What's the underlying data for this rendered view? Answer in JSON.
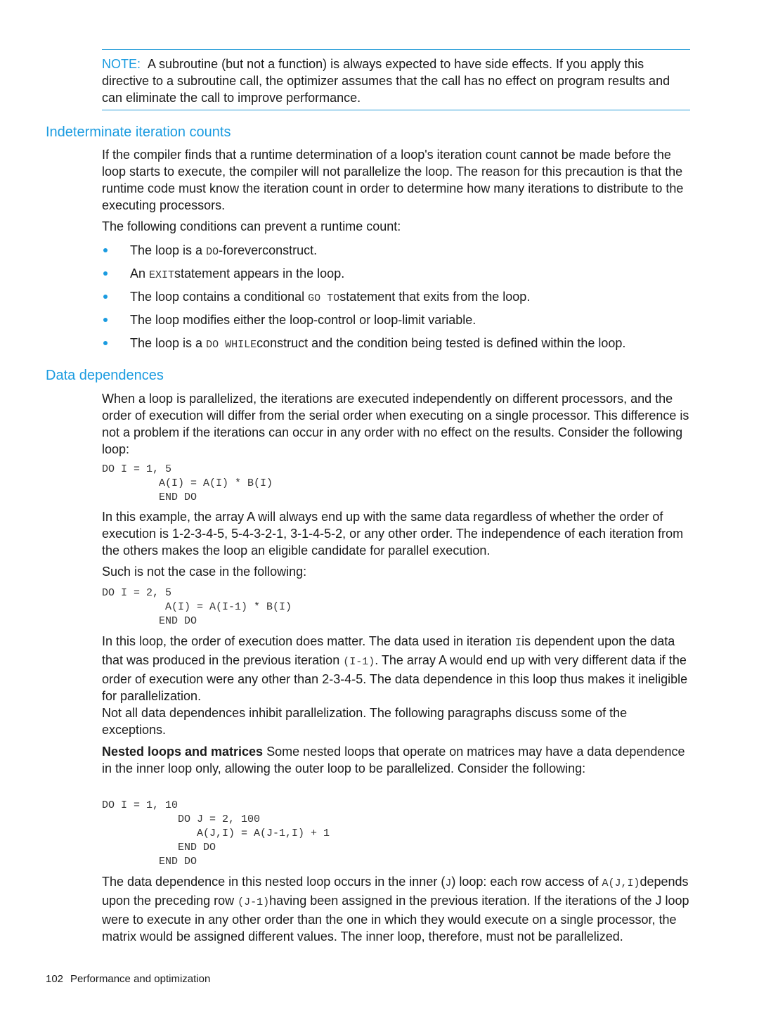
{
  "note": {
    "label": "NOTE:",
    "text": "A subroutine (but not a function) is always expected to have side effects. If you apply this directive to a subroutine call, the optimizer assumes that the call has no effect on program results and can eliminate the call to improve performance."
  },
  "section1": {
    "heading": "Indeterminate iteration counts",
    "para1": "If the compiler finds that a runtime determination of a loop's iteration count cannot be made before the loop starts to execute, the compiler will not parallelize the loop. The reason for this precaution is that the runtime code must know the iteration count in order to determine how many iterations to distribute to the executing processors.",
    "para2": "The following conditions can prevent a runtime count:",
    "bullets": [
      {
        "pre": "The loop is a ",
        "code": "DO",
        "post": "-foreverconstruct."
      },
      {
        "pre": "An ",
        "code": "EXIT",
        "post": "statement appears in the loop."
      },
      {
        "pre": "The loop contains a conditional ",
        "code": "GO TO",
        "post": "statement that exits from the loop."
      },
      {
        "pre": "The loop modifies either the loop-control or loop-limit variable.",
        "code": "",
        "post": ""
      },
      {
        "pre": "The loop is a ",
        "code": "DO WHILE",
        "post": "construct and the condition being tested is defined within the loop."
      }
    ]
  },
  "section2": {
    "heading": "Data dependences",
    "para1": "When a loop is parallelized, the iterations are executed independently on different processors, and the order of execution will differ from the serial order when executing on a single processor. This difference is not a problem if the iterations can occur in any order with no effect on the results. Consider the following loop:",
    "code1": "DO I = 1, 5\n         A(I) = A(I) * B(I)\n         END DO",
    "para2": "In this example, the array A will always end up with the same data regardless of whether the order of execution is 1-2-3-4-5, 5-4-3-2-1, 3-1-4-5-2, or any other order. The independence of each iteration from the others makes the loop an eligible candidate for parallel execution.",
    "para3": "Such is not the case in the following:",
    "code2": "DO I = 2, 5\n          A(I) = A(I-1) * B(I)\n         END DO",
    "para4_a": "In this loop, the order of execution does matter. The data used in iteration ",
    "para4_code1": "I",
    "para4_b": "is dependent upon the data that was produced in the previous iteration ",
    "para4_code2": "(I-1)",
    "para4_c": ". The array A would end up with very different data if the order of execution were any other than 2-3-4-5. The data dependence in this loop thus makes it ineligible for parallelization.",
    "para5": "Not all data dependences inhibit parallelization. The following paragraphs discuss some of the exceptions.",
    "para6_bold": "Nested loops and matrices",
    "para6": " Some nested loops that operate on matrices may have a data dependence in the inner loop only, allowing the outer loop to be parallelized. Consider the following:",
    "code3": "DO I = 1, 10\n            DO J = 2, 100\n               A(J,I) = A(J-1,I) + 1\n            END DO\n         END DO",
    "para7_a": "The data dependence in this nested loop occurs in the inner (",
    "para7_code1": "J",
    "para7_b": ") loop: each row access of ",
    "para7_code2": "A(J,I)",
    "para7_c": "depends upon the preceding row ",
    "para7_code3": "(J-1)",
    "para7_d": "having been assigned in the previous iteration. If the iterations of the J loop were to execute in any other order than the one in which they would execute on a single processor, the matrix would be assigned different values. The inner loop, therefore, must not be parallelized."
  },
  "footer": {
    "page_number": "102",
    "chapter": "Performance and optimization"
  }
}
